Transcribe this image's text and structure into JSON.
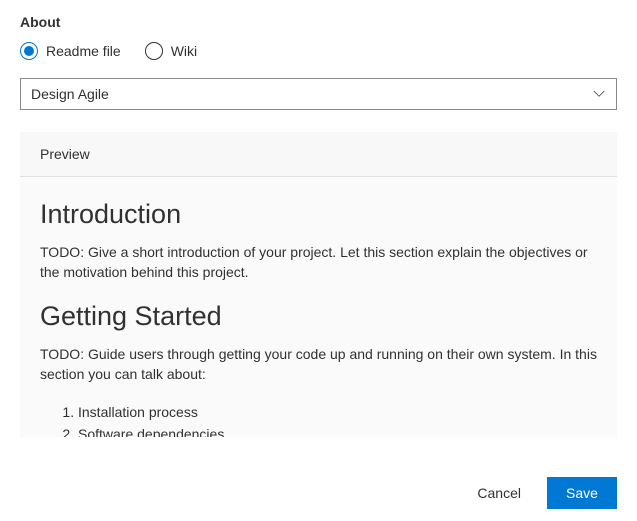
{
  "section_title": "About",
  "radios": {
    "readme_label": "Readme file",
    "wiki_label": "Wiki",
    "selected": "readme"
  },
  "dropdown": {
    "selected": "Design Agile"
  },
  "preview": {
    "tab_label": "Preview",
    "intro_heading": "Introduction",
    "intro_body": "TODO: Give a short introduction of your project. Let this section explain the objectives or the motivation behind this project.",
    "getting_started_heading": "Getting Started",
    "getting_started_body": "TODO: Guide users through getting your code up and running on their own system. In this section you can talk about:",
    "list_item_1": "Installation process",
    "list_item_2": "Software dependencies"
  },
  "footer": {
    "cancel_label": "Cancel",
    "save_label": "Save"
  }
}
